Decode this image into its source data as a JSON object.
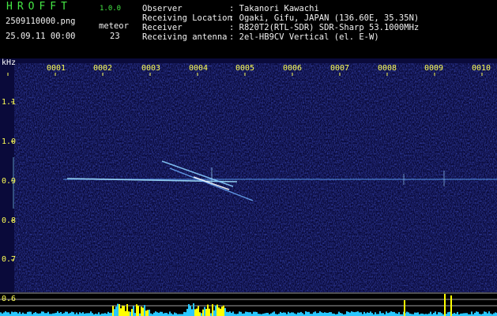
{
  "header": {
    "logo": "HROFFT",
    "version": "1.0.0",
    "filename": "2509110000.png",
    "meteor_label": "meteor",
    "datetime": "25.09.11 00:00",
    "meteor_count": "23",
    "info": [
      {
        "key": "Observer",
        "value": ": Takanori Kawachi"
      },
      {
        "key": "Receiving Location",
        "value": ": Ogaki, Gifu, JAPAN (136.60E, 35.35N)"
      },
      {
        "key": "Receiver",
        "value": ": R820T2(RTL-SDR) SDR-Sharp 53.1000MHz"
      },
      {
        "key": "Receiving antenna",
        "value": ": 2el-HB9CV Vertical (el. E-W)"
      }
    ]
  },
  "spectrogram": {
    "y_unit": "kHz",
    "time_ticks": [
      "0001",
      "0002",
      "0003",
      "0004",
      "0005",
      "0006",
      "0007",
      "0008",
      "0009",
      "0010"
    ],
    "freq_ticks": [
      "1.1",
      "1.0",
      "0.9",
      "0.8",
      "0.7",
      "0.6"
    ],
    "colors": {
      "background": "#0a0a3a",
      "tick": "#ffff55",
      "signal": "#7fc8ff",
      "level": "#29c8ff",
      "peak": "#ffff00"
    }
  }
}
